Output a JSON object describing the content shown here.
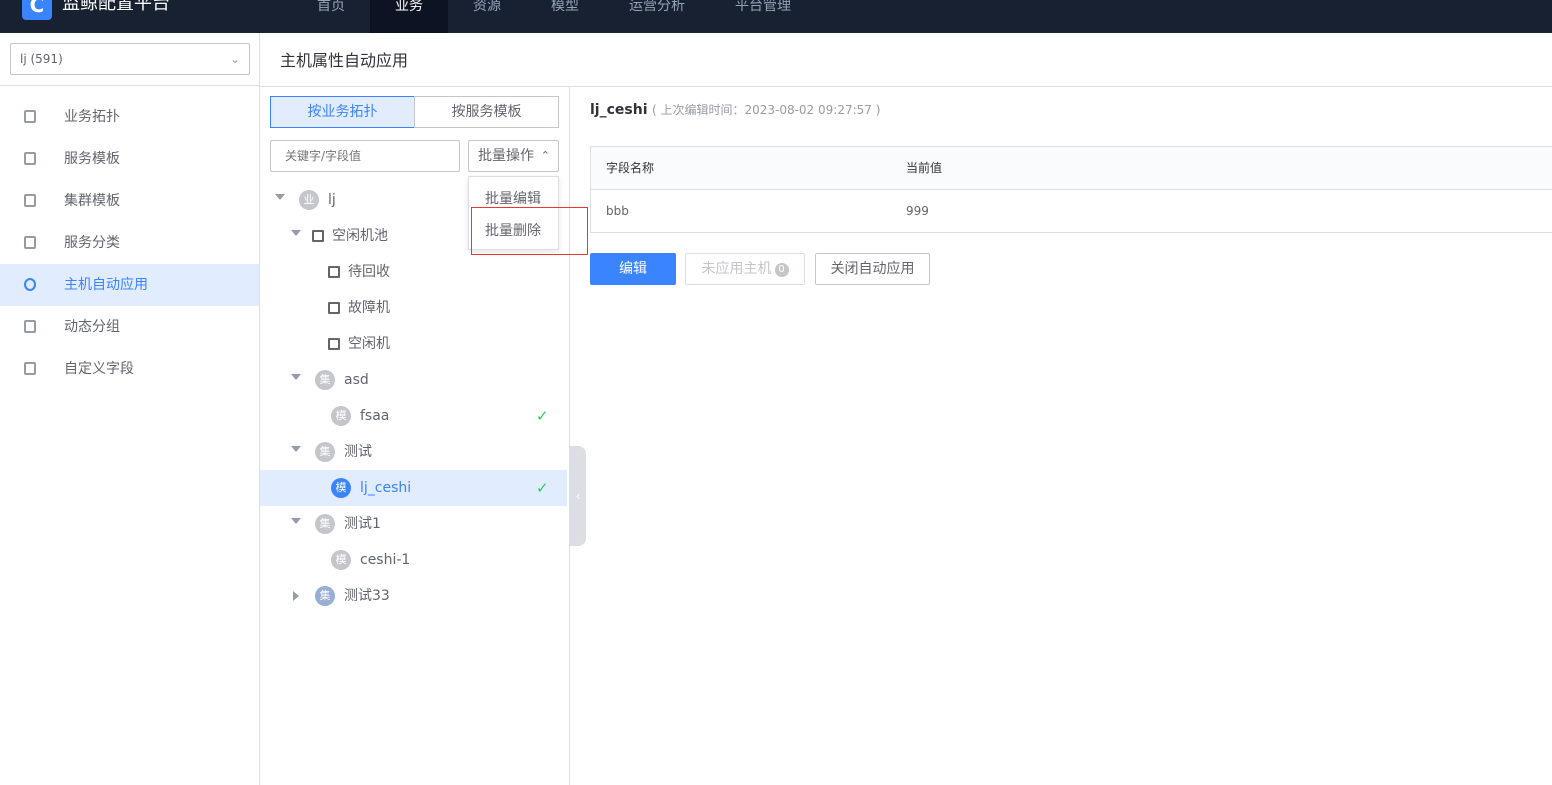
{
  "topbar": {
    "logo_letter": "C",
    "app_title": "监鲸配置平台",
    "nav": [
      {
        "label": "首页"
      },
      {
        "label": "业务",
        "active": true
      },
      {
        "label": "资源"
      },
      {
        "label": "模型"
      },
      {
        "label": "运营分析"
      },
      {
        "label": "平台管理"
      }
    ]
  },
  "sidebar": {
    "business_select": "lj (591)",
    "items": [
      {
        "label": "业务拓扑",
        "icon": "topology-icon"
      },
      {
        "label": "服务模板",
        "icon": "cube-icon"
      },
      {
        "label": "集群模板",
        "icon": "cluster-icon"
      },
      {
        "label": "服务分类",
        "icon": "layers-icon"
      },
      {
        "label": "主机自动应用",
        "icon": "auto-apply-icon",
        "active": true
      },
      {
        "label": "动态分组",
        "icon": "dynamic-group-icon"
      },
      {
        "label": "自定义字段",
        "icon": "custom-field-icon"
      }
    ]
  },
  "page": {
    "title": "主机属性自动应用"
  },
  "tree_panel": {
    "tabs": [
      {
        "label": "按业务拓扑",
        "active": true
      },
      {
        "label": "按服务模板"
      }
    ],
    "search_placeholder": "关键字/字段值",
    "batch_button": "批量操作",
    "batch_menu": [
      "批量编辑",
      "批量删除"
    ],
    "nodes": [
      {
        "badge": "业",
        "label": "lj"
      },
      {
        "badge": "",
        "label": "空闲机池"
      },
      {
        "badge": "",
        "label": "待回收"
      },
      {
        "badge": "",
        "label": "故障机"
      },
      {
        "badge": "",
        "label": "空闲机"
      },
      {
        "badge": "集",
        "label": "asd"
      },
      {
        "badge": "模",
        "label": "fsaa",
        "checked": true
      },
      {
        "badge": "集",
        "label": "测试"
      },
      {
        "badge": "模",
        "label": "lj_ceshi",
        "checked": true,
        "selected": true
      },
      {
        "badge": "集",
        "label": "测试1"
      },
      {
        "badge": "模",
        "label": "ceshi-1"
      },
      {
        "badge": "集",
        "label": "测试33"
      }
    ]
  },
  "detail": {
    "name": "lj_ceshi",
    "edit_time": "( 上次编辑时间：2023-08-02 09:27:57 )",
    "table": {
      "headers": [
        "字段名称",
        "当前值"
      ],
      "rows": [
        [
          "bbb",
          "999"
        ]
      ]
    },
    "buttons": {
      "edit": "编辑",
      "unapplied": "未应用主机",
      "unapplied_count": "0",
      "close_auto": "关闭自动应用"
    }
  },
  "colors": {
    "primary": "#3a84ff",
    "topbar": "#182132",
    "success_check": "#2dcb56",
    "highlight_box": "#ea3636"
  }
}
